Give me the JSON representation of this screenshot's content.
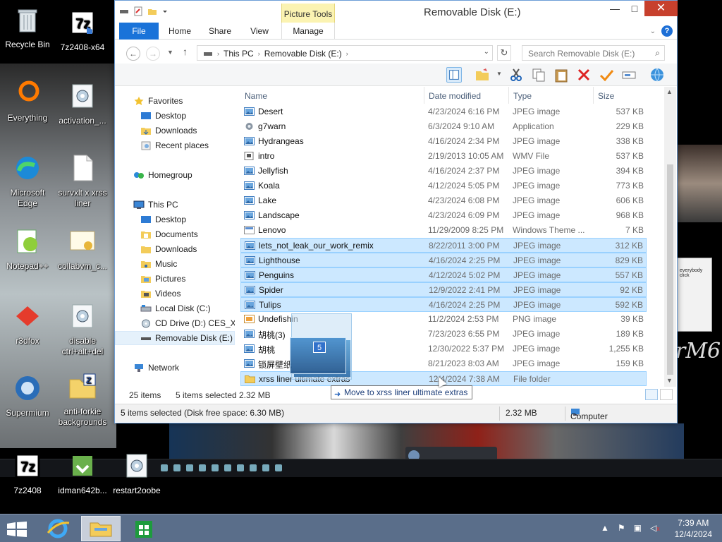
{
  "desktop": {
    "icons": [
      {
        "label": "Recycle Bin"
      },
      {
        "label": "7z2408-x64"
      },
      {
        "label": "Everything"
      },
      {
        "label": "activation_..."
      },
      {
        "label": "Microsoft Edge"
      },
      {
        "label": "survxlt x xrss liner"
      },
      {
        "label": "Notepad++"
      },
      {
        "label": "collabvm_c..."
      },
      {
        "label": "r3dfox"
      },
      {
        "label": "disable ctrl+alt+del"
      },
      {
        "label": "Supermium"
      },
      {
        "label": "anti-forkie backgrounds"
      },
      {
        "label": "7z2408"
      },
      {
        "label": "idman642b..."
      },
      {
        "label": "restart2oobe"
      }
    ],
    "wall_text": "rM6",
    "note_text": "everybody click"
  },
  "window": {
    "title": "Removable Disk (E:)",
    "context_tab": "Picture Tools",
    "tabs": [
      "File",
      "Home",
      "Share",
      "View",
      "Manage"
    ],
    "breadcrumb": [
      "This PC",
      "Removable Disk (E:)"
    ],
    "search_placeholder": "Search Removable Disk (E:)",
    "controls": {
      "minimize": "—",
      "maximize": "□",
      "close": "✕"
    }
  },
  "nav": {
    "favorites": "Favorites",
    "favorites_items": [
      "Desktop",
      "Downloads",
      "Recent places"
    ],
    "homegroup": "Homegroup",
    "thispc": "This PC",
    "thispc_items": [
      "Desktop",
      "Documents",
      "Downloads",
      "Music",
      "Pictures",
      "Videos",
      "Local Disk (C:)",
      "CD Drive (D:) CES_X8",
      "Removable Disk (E:)"
    ],
    "network": "Network"
  },
  "columns": {
    "name": "Name",
    "date": "Date modified",
    "type": "Type",
    "size": "Size"
  },
  "files": [
    {
      "name": "Desert",
      "date": "4/23/2024 6:16 PM",
      "type": "JPEG image",
      "size": "537 KB",
      "icon": "image-icon",
      "selected": false
    },
    {
      "name": "g7warn",
      "date": "6/3/2024 9:10 AM",
      "type": "Application",
      "size": "229 KB",
      "icon": "app-icon",
      "selected": false
    },
    {
      "name": "Hydrangeas",
      "date": "4/16/2024 2:34 PM",
      "type": "JPEG image",
      "size": "338 KB",
      "icon": "image-icon",
      "selected": false
    },
    {
      "name": "intro",
      "date": "2/19/2013 10:05 AM",
      "type": "WMV File",
      "size": "537 KB",
      "icon": "video-icon",
      "selected": false
    },
    {
      "name": "Jellyfish",
      "date": "4/16/2024 2:37 PM",
      "type": "JPEG image",
      "size": "394 KB",
      "icon": "image-icon",
      "selected": false
    },
    {
      "name": "Koala",
      "date": "4/12/2024 5:05 PM",
      "type": "JPEG image",
      "size": "773 KB",
      "icon": "image-icon",
      "selected": false
    },
    {
      "name": "Lake",
      "date": "4/23/2024 6:08 PM",
      "type": "JPEG image",
      "size": "606 KB",
      "icon": "image-icon",
      "selected": false
    },
    {
      "name": "Landscape",
      "date": "4/23/2024 6:09 PM",
      "type": "JPEG image",
      "size": "968 KB",
      "icon": "image-icon",
      "selected": false
    },
    {
      "name": "Lenovo",
      "date": "11/29/2009 8:25 PM",
      "type": "Windows Theme ...",
      "size": "7 KB",
      "icon": "theme-icon",
      "selected": false
    },
    {
      "name": "lets_not_leak_our_work_remix",
      "date": "8/22/2011 3:00 PM",
      "type": "JPEG image",
      "size": "312 KB",
      "icon": "image-icon",
      "selected": true
    },
    {
      "name": "Lighthouse",
      "date": "4/16/2024 2:25 PM",
      "type": "JPEG image",
      "size": "829 KB",
      "icon": "image-icon",
      "selected": true
    },
    {
      "name": "Penguins",
      "date": "4/12/2024 5:02 PM",
      "type": "JPEG image",
      "size": "557 KB",
      "icon": "image-icon",
      "selected": true
    },
    {
      "name": "Spider",
      "date": "12/9/2022 2:41 PM",
      "type": "JPEG image",
      "size": "92 KB",
      "icon": "image-icon",
      "selected": true
    },
    {
      "name": "Tulips",
      "date": "4/16/2024 2:25 PM",
      "type": "JPEG image",
      "size": "592 KB",
      "icon": "image-icon",
      "selected": true
    },
    {
      "name": "Undefishin",
      "date": "11/2/2024 2:53 PM",
      "type": "PNG image",
      "size": "39 KB",
      "icon": "png-icon",
      "selected": false
    },
    {
      "name": "胡桃(3)",
      "date": "7/23/2023 6:55 PM",
      "type": "JPEG image",
      "size": "189 KB",
      "icon": "image-icon",
      "selected": false
    },
    {
      "name": "胡桃",
      "date": "12/30/2022 5:37 PM",
      "type": "JPEG image",
      "size": "1,255 KB",
      "icon": "image-icon",
      "selected": false
    },
    {
      "name": "锁屏壁纸",
      "date": "8/21/2023 8:03 AM",
      "type": "JPEG image",
      "size": "159 KB",
      "icon": "image-icon",
      "selected": false
    },
    {
      "name": "xrss liner ultimate extras",
      "date": "12/4/2024 7:38 AM",
      "type": "File folder",
      "size": "",
      "icon": "folder-icon",
      "selected": false,
      "drop_target": true
    }
  ],
  "drag": {
    "count": "5",
    "tooltip": "Move to xrss liner ultimate extras"
  },
  "itemsbar": {
    "count": "25 items",
    "selected": "5 items selected",
    "size": "2.32 MB"
  },
  "status": {
    "left": "5 items selected (Disk free space: 6.30 MB)",
    "size": "2.32 MB",
    "location": "Computer"
  },
  "taskbar": {
    "time": "7:39 AM",
    "date": "12/4/2024"
  },
  "colors": {
    "selection": "#cce8ff",
    "selection_border": "#99d1ff",
    "file_tab": "#1a73d9",
    "close_btn": "#c7402d",
    "taskbar": "#5a6e8a"
  }
}
